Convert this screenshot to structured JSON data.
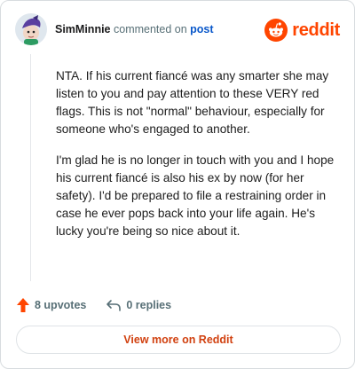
{
  "header": {
    "username": "SimMinnie",
    "action_text": " commented on ",
    "post_link": "post",
    "brand": "reddit"
  },
  "comment": {
    "paragraphs": [
      "NTA. If his current fiancé was any smarter she may listen to you and pay attention to these VERY red flags. This is not \"normal\" behaviour, especially for someone who's engaged to another.",
      "I'm glad he is no longer in touch with you and I hope his current fiancé is also his ex by now (for her safety). I'd be prepared to file a restraining order in case he ever pops back into your life again. He's lucky you're being so nice about it."
    ]
  },
  "actions": {
    "upvotes": "8 upvotes",
    "replies": "0 replies"
  },
  "footer": {
    "view_more": "View more on Reddit"
  },
  "colors": {
    "brand": "#ff4500",
    "link": "#0a58ca",
    "upvote": "#ff4500"
  },
  "icons": [
    "avatar",
    "reddit-logo-icon",
    "upvote-arrow-icon",
    "reply-icon"
  ]
}
